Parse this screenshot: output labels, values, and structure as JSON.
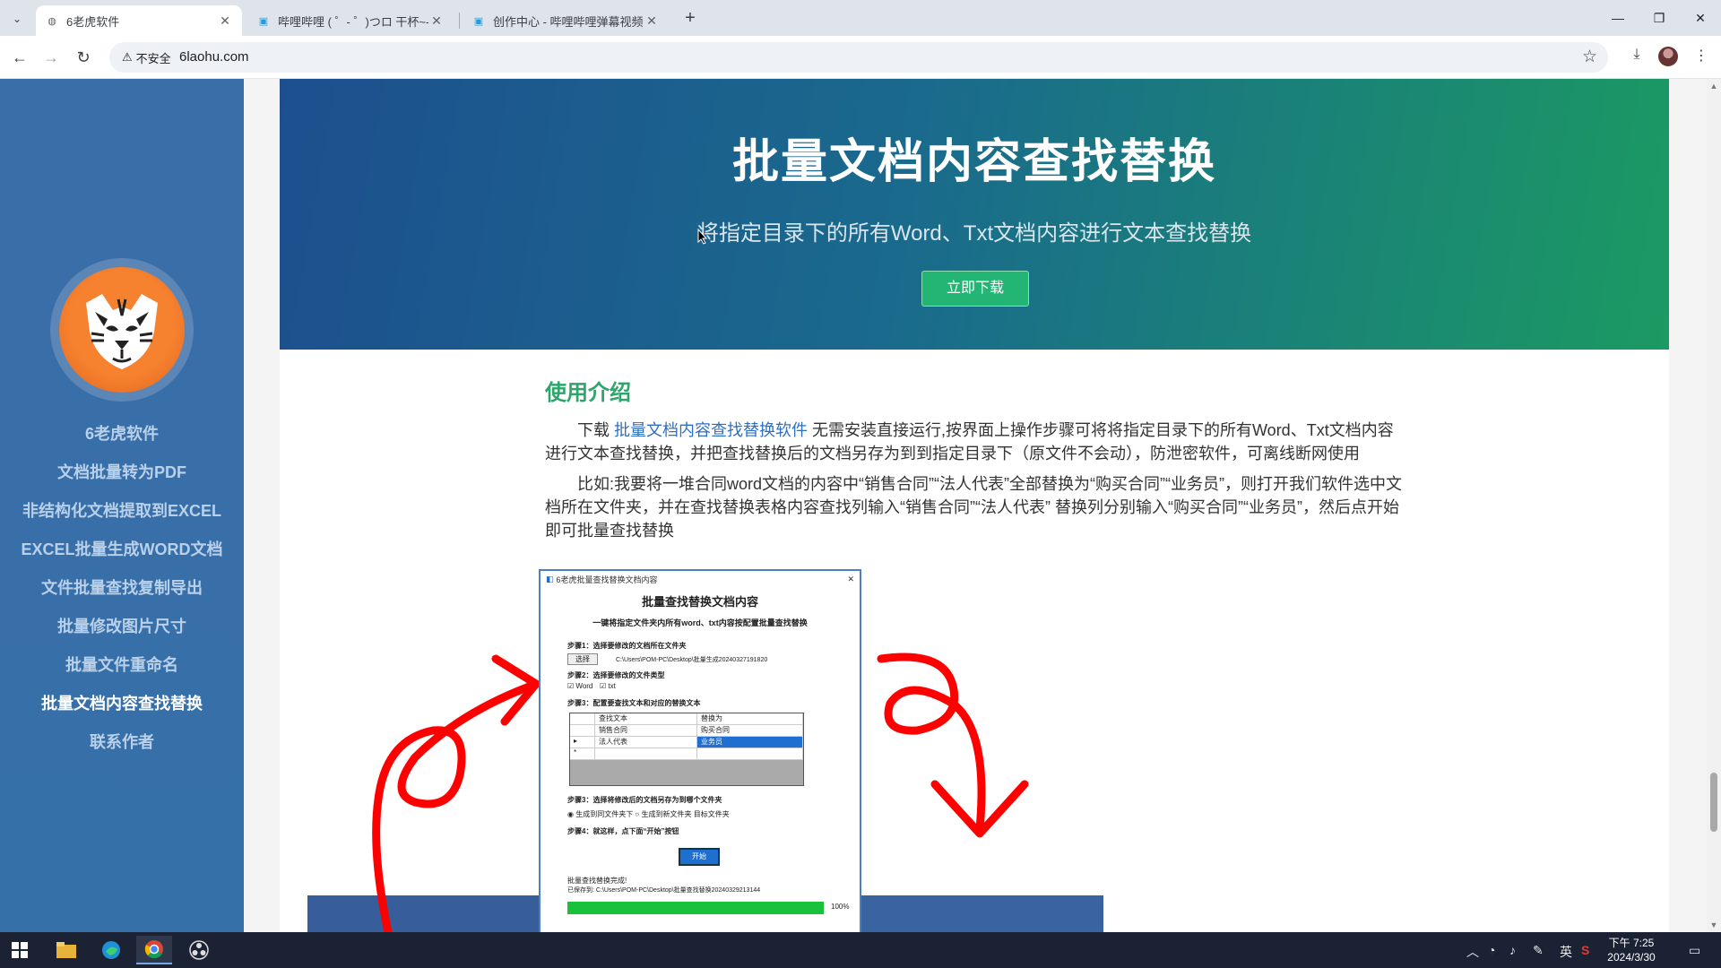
{
  "browser": {
    "tabs": [
      {
        "title": "6老虎软件",
        "active": true
      },
      {
        "title": "哔哩哔哩 ( ゜- ゜)つロ 干杯~-bilibili",
        "active": false
      },
      {
        "title": "创作中心 - 哔哩哔哩弹幕视频网",
        "active": false
      }
    ],
    "security_label": "不安全",
    "url": "6laohu.com"
  },
  "sidebar": {
    "items": [
      {
        "label": "6老虎软件",
        "active": false
      },
      {
        "label": "文档批量转为PDF",
        "active": false
      },
      {
        "label": "非结构化文档提取到EXCEL",
        "active": false
      },
      {
        "label": "EXCEL批量生成WORD文档",
        "active": false
      },
      {
        "label": "文件批量查找复制导出",
        "active": false
      },
      {
        "label": "批量修改图片尺寸",
        "active": false
      },
      {
        "label": "批量文件重命名",
        "active": false
      },
      {
        "label": "批量文档内容查找替换",
        "active": true
      },
      {
        "label": "联系作者",
        "active": false
      }
    ]
  },
  "hero": {
    "title": "批量文档内容查找替换",
    "subtitle": "将指定目录下的所有Word、Txt文档内容进行文本查找替换",
    "download_label": "立即下载"
  },
  "intro": {
    "title": "使用介绍",
    "para1_prefix": "下载 ",
    "para1_link": "批量文档内容查找替换软件",
    "para1_rest": " 无需安装直接运行,按界面上操作步骤可将将指定目录下的所有Word、Txt文档内容进行文本查找替换，并把查找替换后的文档另存为到到指定目录下（原文件不会动），防泄密软件，可离线断网使用",
    "para2": "比如:我要将一堆合同word文档的内容中“销售合同”“法人代表”全部替换为“购买合同”“业务员”，则打开我们软件选中文档所在文件夹，并在查找替换表格内容查找列输入“销售合同”“法人代表” 替换列分别输入“购买合同”“业务员”，然后点开始即可批量查找替换"
  },
  "screenshot": {
    "window_title": "6老虎批量查找替换文档内容",
    "heading": "批量查找替换文档内容",
    "subheading": "一键将指定文件夹内所有word、txt内容按配置批量查找替换",
    "step1": "步骤1：选择要修改的文档所在文件夹",
    "choose_label": "选择",
    "step1_path": "C:\\Users\\POM-PC\\Desktop\\批量生成20240327191820",
    "step2": "步骤2：选择要修改的文件类型",
    "type_word": "Word",
    "type_txt": "txt",
    "step3": "步骤3：配置要查找文本和对应的替换文本",
    "col_find": "查找文本",
    "col_replace": "替换为",
    "rows": [
      {
        "find": "销售合同",
        "replace": "购买合同"
      },
      {
        "find": "法人代表",
        "replace": "业务员"
      }
    ],
    "step3b": "步骤3：选择将修改后的文档另存为到哪个文件夹",
    "opt1": "生成到同文件夹下",
    "opt2": "生成到新文件夹",
    "opt3": "目标文件夹",
    "step4": "步骤4：就这样，点下面“开始”按钮",
    "start_label": "开始",
    "done_line1": "批量查找替换完成!",
    "done_line2": "已保存到: C:\\Users\\POM-PC\\Desktop\\批量查找替换20240329213144",
    "progress_pct": 100,
    "progress_label": "100%"
  },
  "taskbar": {
    "ime": "英",
    "time": "下午 7:25",
    "date": "2024/3/30"
  },
  "colors": {
    "sidebar": "#3a6ea8",
    "accent_green": "#22b573",
    "title_green": "#2ea56a",
    "link_blue": "#2f6fbf"
  }
}
